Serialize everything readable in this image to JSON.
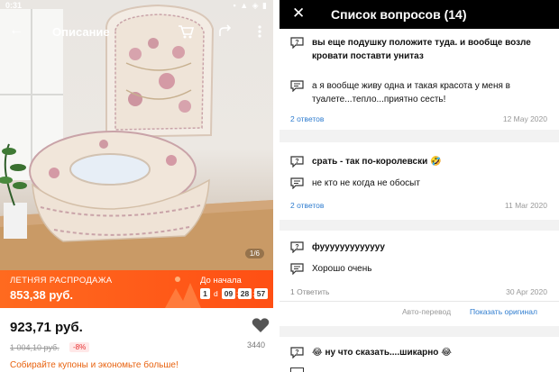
{
  "status_bar": {
    "time": "0:31",
    "indicators": "▪ ▲ ◈ ▮"
  },
  "product_screen": {
    "app_bar": {
      "back_icon": "arrow-left-icon",
      "title": "Описание"
    },
    "image_indicator": "1/6",
    "promo": {
      "sale_label": "ЛЕТНЯЯ РАСПРОДАЖА",
      "sale_price": "853,38 руб.",
      "until_label": "До начала",
      "countdown": {
        "days": "1",
        "days_suffix": "d",
        "hours": "09",
        "minutes": "28",
        "seconds": "57"
      },
      "color": "#ff5a19"
    },
    "price": "923,71 руб.",
    "old_price": "1 004,10 руб.",
    "discount": "-8%",
    "coupon_message": "Собирайте купоны и экономьте больше!",
    "favorite_count": "3440"
  },
  "questions_screen": {
    "close_icon": "close-icon",
    "title": "Список вопросов (14)",
    "link_color": "#2e7ccf",
    "items": [
      {
        "question": "вы еще подушку положите туда. и вообще возле кровати поставти унитаз",
        "answer": "а я вообще живу одна и такая красота у меня в туалете...тепло...приятно сесть!",
        "answers_count": "2 ответов",
        "date": "12 May 2020"
      },
      {
        "question": "срать - так по-королевски 🤣",
        "answer": "не кто не когда не обосыт",
        "answers_count": "2 ответов",
        "date": "11 Mar 2020"
      },
      {
        "question": "фууууууууууууу",
        "answer": "Хорошо очень",
        "answers_count": "1 Ответить",
        "date": "30 Apr 2020",
        "auto_translate": "Авто-перевод",
        "show_original": "Показать оригинал"
      },
      {
        "question": "😂 ну что сказать....шикарно 😂"
      }
    ]
  }
}
